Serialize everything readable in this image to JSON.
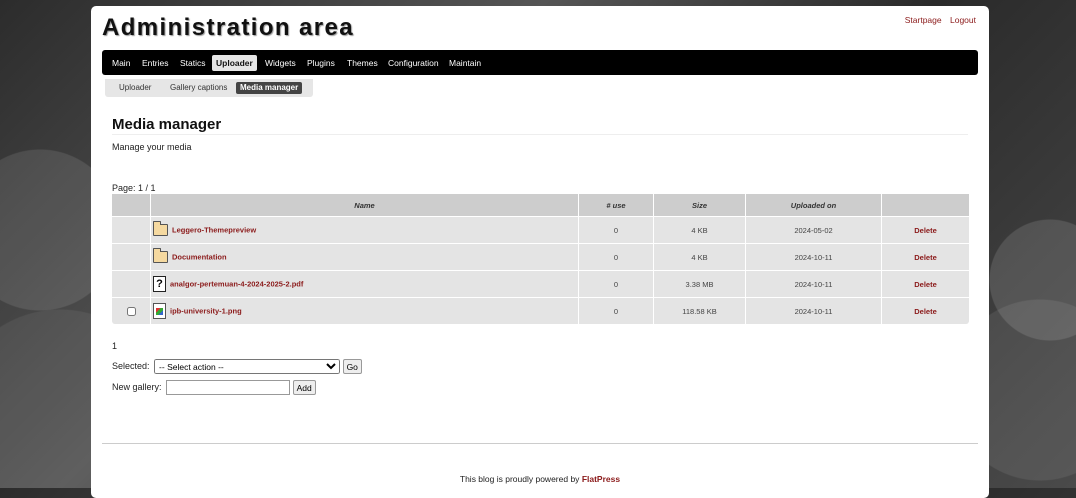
{
  "header": {
    "title": "Administration area",
    "links": [
      "Startpage",
      "Logout"
    ]
  },
  "nav": {
    "tabs": [
      "Main",
      "Entries",
      "Statics",
      "Uploader",
      "Widgets",
      "Plugins",
      "Themes",
      "Configuration",
      "Maintain"
    ],
    "active": "Uploader"
  },
  "subnav": {
    "tabs": [
      "Uploader",
      "Gallery captions",
      "Media manager"
    ],
    "active": "Media manager"
  },
  "main": {
    "heading": "Media manager",
    "subtitle": "Manage your media",
    "page_info": "Page: 1 / 1"
  },
  "table": {
    "columns": [
      "",
      "Name",
      "# use",
      "Size",
      "Uploaded on",
      ""
    ],
    "rows": [
      {
        "icon": "folder-icon",
        "name": "Leggero-Themepreview",
        "use": "0",
        "size": "4 KB",
        "date": "2024-05-02",
        "action": "Delete",
        "checkbox": false
      },
      {
        "icon": "folder-icon",
        "name": "Documentation",
        "use": "0",
        "size": "4 KB",
        "date": "2024-10-11",
        "action": "Delete",
        "checkbox": false
      },
      {
        "icon": "unknown-file-icon",
        "name": "analgor-pertemuan-4-2024-2025-2.pdf",
        "use": "0",
        "size": "3.38 MB",
        "date": "2024-10-11",
        "action": "Delete",
        "checkbox": false
      },
      {
        "icon": "image-file-icon",
        "name": "ipb-university-1.png",
        "use": "0",
        "size": "118.58 KB",
        "date": "2024-10-11",
        "action": "Delete",
        "checkbox": true
      }
    ]
  },
  "pagination": "1",
  "bulk": {
    "selected_label": "Selected:",
    "select_value": "-- Select action --",
    "go_label": "Go",
    "gallery_label": "New gallery:",
    "gallery_value": "",
    "add_label": "Add"
  },
  "footer": {
    "text": "This blog is proudly powered by",
    "link": "FlatPress"
  },
  "colors": {
    "link": "#8b1a1a",
    "navbar": "#000000",
    "table_bg": "#e4e4e4"
  }
}
